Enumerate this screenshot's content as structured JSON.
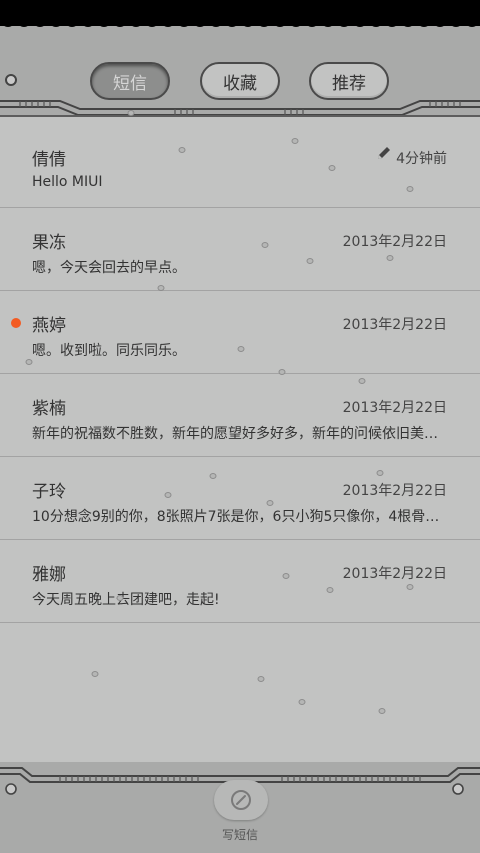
{
  "tabs": [
    {
      "label": "短信",
      "active": true
    },
    {
      "label": "收藏",
      "active": false
    },
    {
      "label": "推荐",
      "active": false
    }
  ],
  "messages": [
    {
      "name": "倩倩",
      "preview": "Hello MIUI",
      "time": "4分钟前",
      "draft": true,
      "unread": false
    },
    {
      "name": "果冻",
      "preview": "嗯，今天会回去的早点。",
      "time": "2013年2月22日",
      "draft": false,
      "unread": false
    },
    {
      "name": "燕婷",
      "preview": "嗯。收到啦。同乐同乐。",
      "time": "2013年2月22日",
      "draft": false,
      "unread": true
    },
    {
      "name": "紫楠",
      "preview": "新年的祝福数不胜数，新年的愿望好多好多，新年的问候依旧美好…",
      "time": "2013年2月22日",
      "draft": false,
      "unread": false
    },
    {
      "name": "子玲",
      "preview": "10分想念9别的你，8张照片7张是你，6只小狗5只像你，4根骨头…",
      "time": "2013年2月22日",
      "draft": false,
      "unread": false
    },
    {
      "name": "雅娜",
      "preview": "今天周五晚上去团建吧，走起!",
      "time": "2013年2月22日",
      "draft": false,
      "unread": false
    }
  ],
  "compose": {
    "label": "写短信",
    "icon": "compose-icon"
  },
  "colors": {
    "background": "#a9aaa9",
    "panel": "#c2c3c2",
    "unread": "#f35b22"
  }
}
